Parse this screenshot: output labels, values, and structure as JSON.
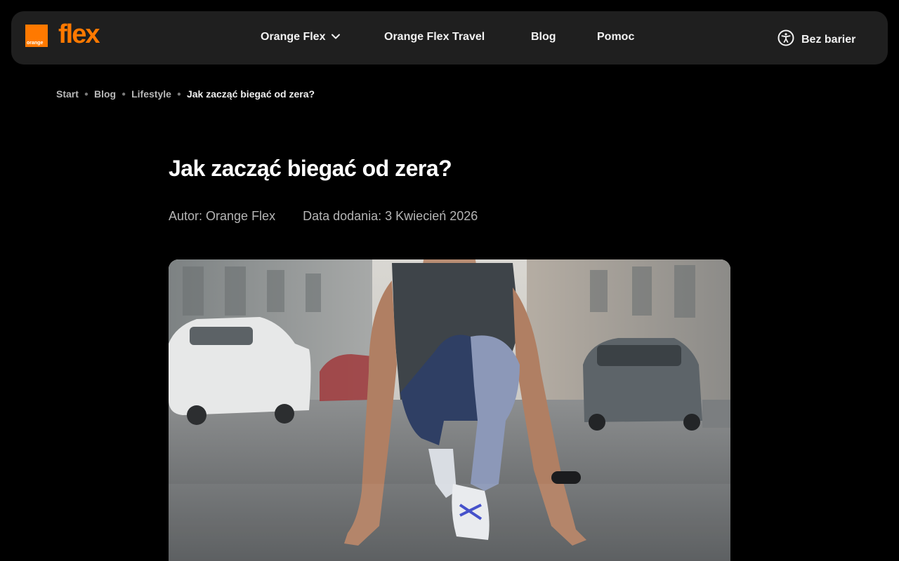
{
  "brand": {
    "logo_small_text": "orange",
    "logo_text": "flex",
    "accent_color": "#ff7900"
  },
  "nav": {
    "items": [
      {
        "label": "Orange Flex",
        "has_dropdown": true
      },
      {
        "label": "Orange Flex Travel"
      },
      {
        "label": "Blog"
      },
      {
        "label": "Pomoc"
      }
    ],
    "accessibility_label": "Bez barier"
  },
  "breadcrumb": {
    "items": [
      "Start",
      "Blog",
      "Lifestyle"
    ],
    "current": "Jak zacząć biegać od zera?"
  },
  "article": {
    "title": "Jak zacząć biegać od zera?",
    "author": "Autor: Orange Flex",
    "date": "Data dodania: 3 Kwiecień 2026",
    "hero_image_alt": "runner in starting position on a wet city street"
  }
}
